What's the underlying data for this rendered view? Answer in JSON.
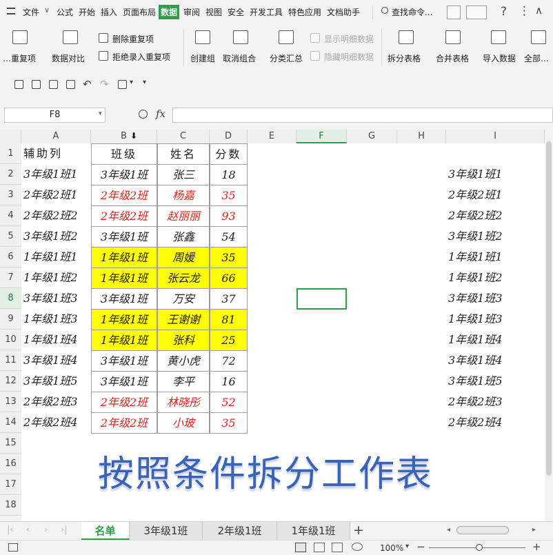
{
  "menu": {
    "items": [
      "文件",
      "公式",
      "开始",
      "插入",
      "页面布局",
      "数据",
      "审阅",
      "视图",
      "安全",
      "开发工具",
      "特色应用",
      "文档助手"
    ],
    "active": "数据",
    "search": "查找命令..."
  },
  "ribbon": {
    "dup_label": "…重复项",
    "compare_label": "数据对比",
    "del_dup": "删除重复项",
    "reject_dup": "拒绝录入重复项",
    "create_group": "创建组",
    "ungroup": "取消组合",
    "subtotal": "分类汇总",
    "show_detail": "显示明细数据",
    "hide_detail": "隐藏明细数据",
    "split_table": "拆分表格",
    "merge_table": "合并表格",
    "import_data": "导入数据",
    "all_label": "全部…"
  },
  "formula_bar": {
    "name_box": "F8",
    "fx": "fx",
    "content": ""
  },
  "columns": [
    "A",
    "B",
    "C",
    "D",
    "E",
    "F",
    "G",
    "H",
    "I"
  ],
  "selected_column": "F",
  "selected_row": "8",
  "rows": [
    "1",
    "2",
    "3",
    "4",
    "5",
    "6",
    "7",
    "8",
    "9",
    "10",
    "11",
    "12",
    "13",
    "14",
    "15",
    "16",
    "17",
    "18"
  ],
  "table": {
    "headers": [
      "辅助列",
      "班级",
      "姓名",
      "分数"
    ],
    "data": [
      [
        "3年级1班1",
        "3年级1班",
        "张三",
        "18"
      ],
      [
        "2年级2班1",
        "2年级2班",
        "杨嘉",
        "35"
      ],
      [
        "2年级2班2",
        "2年级2班",
        "赵丽丽",
        "93"
      ],
      [
        "3年级1班2",
        "3年级1班",
        "张鑫",
        "54"
      ],
      [
        "1年级1班1",
        "1年级1班",
        "周媛",
        "35"
      ],
      [
        "1年级1班2",
        "1年级1班",
        "张云龙",
        "66"
      ],
      [
        "3年级1班3",
        "3年级1班",
        "万安",
        "37"
      ],
      [
        "1年级1班3",
        "1年级1班",
        "王谢谢",
        "81"
      ],
      [
        "1年级1班4",
        "1年级1班",
        "张科",
        "25"
      ],
      [
        "3年级1班4",
        "3年级1班",
        "黄小虎",
        "72"
      ],
      [
        "3年级1班5",
        "3年级1班",
        "李平",
        "16"
      ],
      [
        "2年级2班3",
        "2年级2班",
        "林晓彤",
        "52"
      ],
      [
        "2年级2班4",
        "2年级2班",
        "小玻",
        "35"
      ]
    ]
  },
  "column_i": [
    "3年级1班1",
    "2年级2班1",
    "2年级2班2",
    "3年级1班2",
    "1年级1班1",
    "1年级1班2",
    "3年级1班3",
    "1年级1班3",
    "1年级1班4",
    "3年级1班4",
    "3年级1班5",
    "2年级2班3",
    "2年级2班4"
  ],
  "title_art": "按照条件拆分工作表",
  "sheet_tabs": [
    "名单",
    "3年级1班",
    "2年级1班",
    "1年级1班"
  ],
  "active_tab": "名单",
  "status": {
    "zoom": "100%"
  },
  "colors": {
    "accent": "#2e9e4b",
    "highlight": "#ffff00",
    "red_text": "#e0221b",
    "title_blue": "#3a62b5"
  }
}
